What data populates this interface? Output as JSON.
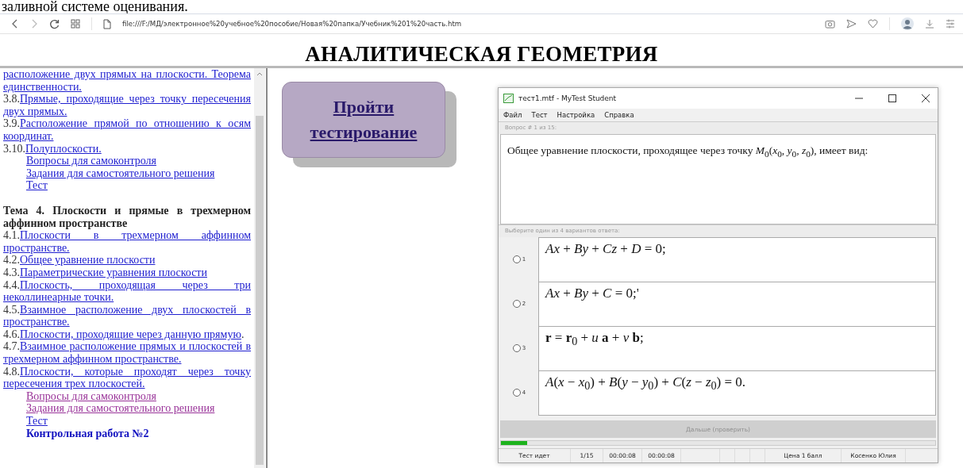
{
  "top_text": "заливной системе оценивания.",
  "browser": {
    "url": "file:///F:/МД/электронное%20учебное%20пособие/Новая%20папка/Учебник%201%20часть.htm"
  },
  "page_title": "АНАЛИТИЧЕСКАЯ ГЕОМЕТРИЯ",
  "sidebar": [
    {
      "kind": "item",
      "link": "расположение двух прямых на плоскости. Теорема единственности.",
      "visited": false
    },
    {
      "kind": "item",
      "num": "3.8.",
      "link": "Прямые, проходящие через точку пересечения двух прямых.",
      "visited": false
    },
    {
      "kind": "item",
      "num": "3.9.",
      "link": "Расположение прямой по отношению к осям координат.",
      "visited": false
    },
    {
      "kind": "item",
      "num": "3.10.",
      "link": "Полуплоскости.",
      "visited": false
    },
    {
      "kind": "sub",
      "link": "Вопросы для самоконтроля",
      "visited": false
    },
    {
      "kind": "sub",
      "link": "Задания для самостоятельного решения",
      "visited": false
    },
    {
      "kind": "sub",
      "link": "Тест",
      "visited": false
    },
    {
      "kind": "heading",
      "text": "Тема 4. Плоскости и прямые в трехмерном аффинном пространстве"
    },
    {
      "kind": "item",
      "num": "4.1.",
      "link": "Плоскости в трехмерном аффинном пространстве.",
      "visited": false
    },
    {
      "kind": "item",
      "num": "4.2.",
      "link": "Общее уравнение плоскости",
      "visited": false
    },
    {
      "kind": "item",
      "num": "4.3.",
      "link": "Параметрические уравнения плоскости",
      "visited": false
    },
    {
      "kind": "item",
      "num": "4.4.",
      "link": "Плоскость, проходящая через три неколлинеарные точки.",
      "visited": false
    },
    {
      "kind": "item",
      "num": "4.5.",
      "link": "Взаимное расположение двух плоскостей в пространстве.",
      "visited": false
    },
    {
      "kind": "item",
      "num": "4.6.",
      "link": "Плоскости, проходящие через данную прямую",
      "after": ".",
      "visited": false
    },
    {
      "kind": "item",
      "num": "4.7.",
      "link": "Взаимное расположение прямых и плоскостей в трехмерном аффинном пространстве.",
      "visited": false
    },
    {
      "kind": "item",
      "num": "4.8.",
      "link": "Плоскости, которые проходят через точку пересечения трех плоскостей.",
      "visited": false
    },
    {
      "kind": "sub",
      "link": "Вопросы для самоконтроля",
      "visited": true
    },
    {
      "kind": "sub",
      "link": "Задания для самостоятельного решения",
      "visited": true
    },
    {
      "kind": "sub",
      "link": "Тест",
      "visited": false
    },
    {
      "kind": "bold",
      "link": "Контрольная работа №2",
      "visited": false
    }
  ],
  "test_button": "Пройти тестирование",
  "mytest": {
    "title": "тест1.mtf - MyTest Student",
    "menu": [
      "Файл",
      "Тест",
      "Настройка",
      "Справка"
    ],
    "question_header": "Вопрос # 1 из 15:",
    "question": "Общее уравнение плоскости, проходящее через точку *M*$_{0}$(*x*$_{0}$, *y*$_{0}$, *z*$_{0}$), имеет вид:",
    "answers_header": "Выберите один из 4 вариантов ответа:",
    "options": [
      {
        "number": "1",
        "text": "*Ax* + *By* + *Cz* + *D* = 0;",
        "selected": false
      },
      {
        "number": "2",
        "text": "*Ax* + *By* + *C* = 0;'",
        "selected": false
      },
      {
        "number": "3",
        "text": "**r** = **r**$_{0}$ + *u* **a** + *v* **b**;",
        "selected": false
      },
      {
        "number": "4",
        "text": "*A*(*x* − *x*$_{0}$) + *B*(*y* − *y*$_{0}$) + *C*(*z* − *z*$_{0}$) = 0.",
        "selected": false
      }
    ],
    "next_button": {
      "label": "Дальше (проверить)",
      "disabled": true
    },
    "progress": {
      "level": 0.06
    },
    "status": [
      "Тест идет",
      "1/15",
      "00:00:08",
      "00:00:08",
      "Цена 1 балл",
      "Косенко Юлия"
    ]
  }
}
